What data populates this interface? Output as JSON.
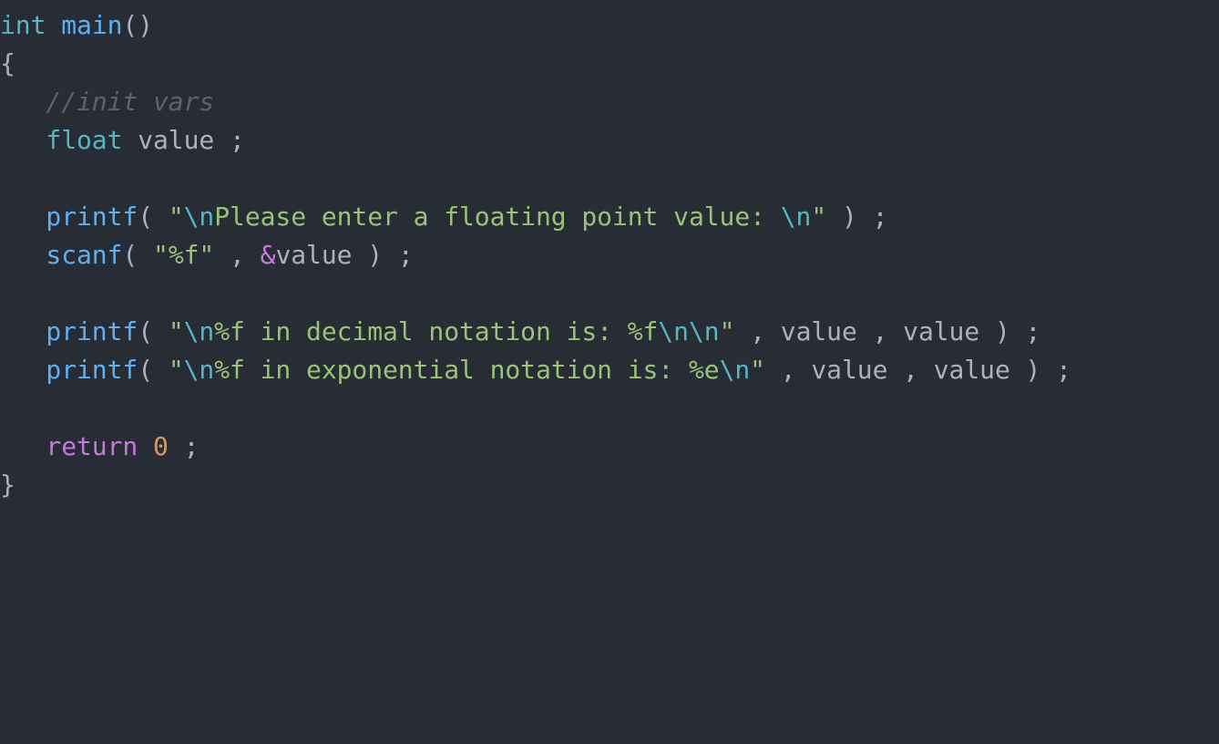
{
  "colors": {
    "background": "#282c34",
    "plain": "#abb2bf",
    "type": "#56b6c2",
    "function": "#61afef",
    "string": "#98c379",
    "escape": "#56b6c2",
    "keyword": "#c678dd",
    "number": "#d19a66",
    "comment": "#5c6370"
  },
  "code": {
    "lines": [
      [
        {
          "type": "type",
          "text": "int"
        },
        {
          "type": "plain",
          "text": " "
        },
        {
          "type": "function",
          "text": "main"
        },
        {
          "type": "plain",
          "text": "()"
        }
      ],
      [
        {
          "type": "plain",
          "text": "{"
        }
      ],
      [
        {
          "type": "plain",
          "text": "   "
        },
        {
          "type": "comment",
          "text": "//init vars"
        }
      ],
      [
        {
          "type": "plain",
          "text": "   "
        },
        {
          "type": "type",
          "text": "float"
        },
        {
          "type": "plain",
          "text": " value ;"
        }
      ],
      [],
      [
        {
          "type": "plain",
          "text": "   "
        },
        {
          "type": "function",
          "text": "printf"
        },
        {
          "type": "plain",
          "text": "( "
        },
        {
          "type": "string",
          "text": "\""
        },
        {
          "type": "escape",
          "text": "\\n"
        },
        {
          "type": "string",
          "text": "Please enter a floating point value: "
        },
        {
          "type": "escape",
          "text": "\\n"
        },
        {
          "type": "string",
          "text": "\""
        },
        {
          "type": "plain",
          "text": " ) ;"
        }
      ],
      [
        {
          "type": "plain",
          "text": "   "
        },
        {
          "type": "function",
          "text": "scanf"
        },
        {
          "type": "plain",
          "text": "( "
        },
        {
          "type": "string",
          "text": "\"%f\""
        },
        {
          "type": "plain",
          "text": " , "
        },
        {
          "type": "keyword",
          "text": "&"
        },
        {
          "type": "plain",
          "text": "value ) ;"
        }
      ],
      [],
      [
        {
          "type": "plain",
          "text": "   "
        },
        {
          "type": "function",
          "text": "printf"
        },
        {
          "type": "plain",
          "text": "( "
        },
        {
          "type": "string",
          "text": "\""
        },
        {
          "type": "escape",
          "text": "\\n"
        },
        {
          "type": "string",
          "text": "%f in decimal notation is: %f"
        },
        {
          "type": "escape",
          "text": "\\n\\n"
        },
        {
          "type": "string",
          "text": "\""
        },
        {
          "type": "plain",
          "text": " , value , value ) ;"
        }
      ],
      [
        {
          "type": "plain",
          "text": "   "
        },
        {
          "type": "function",
          "text": "printf"
        },
        {
          "type": "plain",
          "text": "( "
        },
        {
          "type": "string",
          "text": "\""
        },
        {
          "type": "escape",
          "text": "\\n"
        },
        {
          "type": "string",
          "text": "%f in exponential notation is: %e"
        },
        {
          "type": "escape",
          "text": "\\n"
        },
        {
          "type": "string",
          "text": "\""
        },
        {
          "type": "plain",
          "text": " , value , value ) ;"
        }
      ],
      [],
      [
        {
          "type": "plain",
          "text": "   "
        },
        {
          "type": "keyword",
          "text": "return"
        },
        {
          "type": "plain",
          "text": " "
        },
        {
          "type": "number",
          "text": "0"
        },
        {
          "type": "plain",
          "text": " ;"
        }
      ],
      [
        {
          "type": "plain",
          "text": "}"
        }
      ]
    ]
  }
}
